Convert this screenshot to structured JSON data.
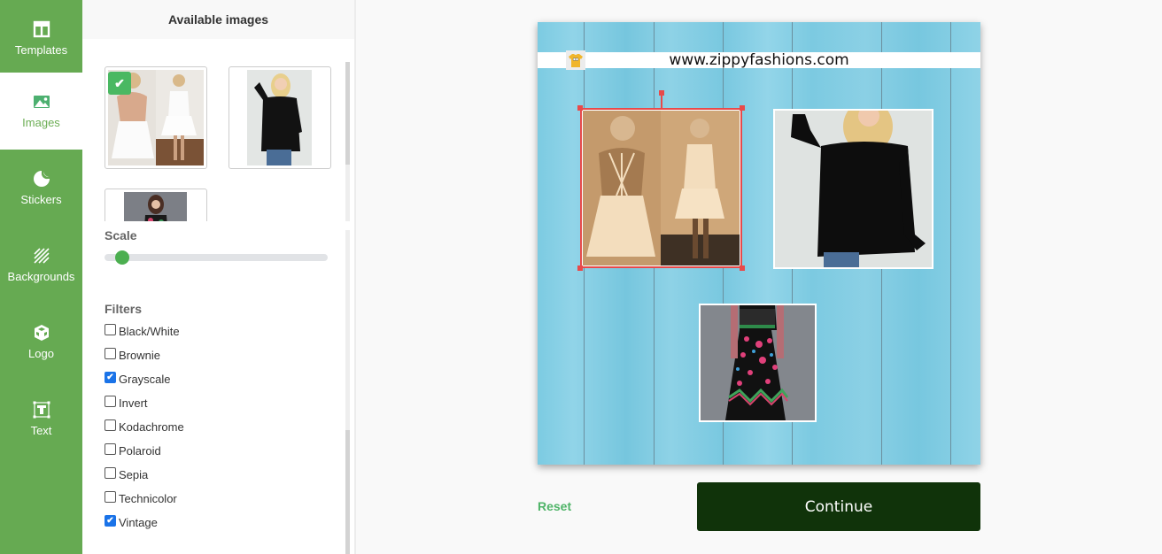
{
  "nav": {
    "items": [
      {
        "label": "Templates",
        "icon": "template-icon",
        "active": false
      },
      {
        "label": "Images",
        "icon": "image-icon",
        "active": true
      },
      {
        "label": "Stickers",
        "icon": "sticker-icon",
        "active": false
      },
      {
        "label": "Backgrounds",
        "icon": "backgrounds-icon",
        "active": false
      },
      {
        "label": "Logo",
        "icon": "logo-cube-icon",
        "active": false
      },
      {
        "label": "Text",
        "icon": "text-icon",
        "active": false
      }
    ]
  },
  "panel": {
    "title": "Available images",
    "images": [
      {
        "name": "white-halter-dress",
        "selected": true
      },
      {
        "name": "black-bell-sleeve-top",
        "selected": false
      },
      {
        "name": "floral-embroidered-dress",
        "selected": false
      }
    ],
    "scale_label": "Scale",
    "scale_value": 0.08,
    "filters_label": "Filters",
    "filters": [
      {
        "label": "Black/White",
        "checked": false
      },
      {
        "label": "Brownie",
        "checked": false
      },
      {
        "label": "Grayscale",
        "checked": true
      },
      {
        "label": "Invert",
        "checked": false
      },
      {
        "label": "Kodachrome",
        "checked": false
      },
      {
        "label": "Polaroid",
        "checked": false
      },
      {
        "label": "Sepia",
        "checked": false
      },
      {
        "label": "Technicolor",
        "checked": false
      },
      {
        "label": "Vintage",
        "checked": true
      }
    ]
  },
  "canvas": {
    "banner_text": "www.zippyfashions.com",
    "logo": "t-shirt-logo",
    "selection_color": "#e84a4a"
  },
  "actions": {
    "reset_label": "Reset",
    "continue_label": "Continue"
  },
  "colors": {
    "nav_green": "#66aa52",
    "check_green": "#4ab862",
    "continue_bg": "#10330a",
    "reset_text": "#4fb468"
  }
}
